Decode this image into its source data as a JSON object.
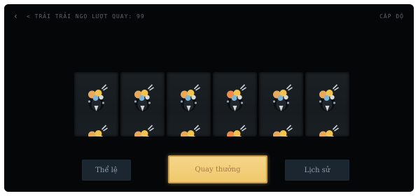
{
  "topbar": {
    "title": "< TRẢI TRẢI NGỌ LƯỢT QUAY: 99",
    "right": "CẤP ĐỘ"
  },
  "reels": {
    "count": 6,
    "symbol": "coin-pouch-icon",
    "symbol_colors": [
      "#e9a95a",
      "#f2c44f",
      "#7fb6d8",
      "#d9d9d9",
      "#f08a4b"
    ],
    "reel_background": "#1a1f23"
  },
  "buttons": {
    "left_label": "Thể lệ",
    "center_label": "Quay thưởng",
    "right_label": "Lịch sử"
  },
  "colors": {
    "background": "#050608",
    "accent": "#f0c96c",
    "side_button": "#1b2630"
  }
}
